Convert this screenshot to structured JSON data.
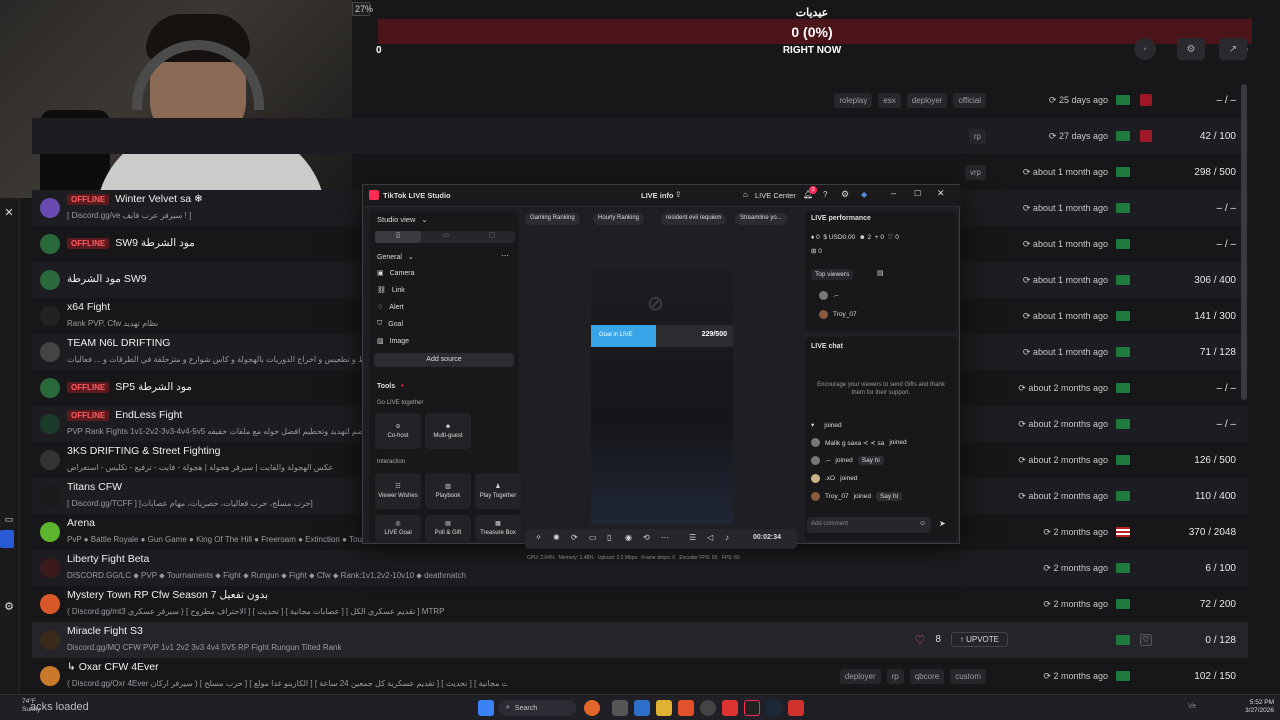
{
  "top": {
    "percent_tag": "27%",
    "title": "عيديات",
    "progress_text": "0 (0%)",
    "progress_min": "0",
    "progress_label": "RIGHT NOW",
    "progress_max": "100",
    "progress_fraction": 0.0
  },
  "rows": [
    {
      "offline": "",
      "name": "",
      "desc": "",
      "tags": [
        "roleplay",
        "esx",
        "deployer",
        "official"
      ],
      "time": "25 days ago",
      "count": "– / –",
      "fav": true
    },
    {
      "offline": "",
      "name": "",
      "desc": "",
      "tags": [
        "rp"
      ],
      "time": "27 days ago",
      "count": "42 / 100",
      "fav": true
    },
    {
      "offline": "",
      "name": "",
      "desc": "",
      "tags": [
        "vrp"
      ],
      "time": "about 1 month ago",
      "count": "298 / 500"
    },
    {
      "offline": "OFFLINE",
      "name": "Winter Velvet sa ❄",
      "desc": "[ Discord.gg/ve سيرفر عرب فايف ! ]",
      "tags": [],
      "time": "about 1 month ago",
      "count": "– / –"
    },
    {
      "offline": "OFFLINE",
      "name": "SW9 مود الشرطة",
      "desc": "",
      "tags": [],
      "time": "about 1 month ago",
      "count": "– / –"
    },
    {
      "offline": "",
      "name": "مود الشرطة SW9",
      "desc": "",
      "tags": [],
      "time": "about 1 month ago",
      "count": "306 / 400"
    },
    {
      "offline": "",
      "name": "x64 Fight",
      "desc": "Rank PVP, Cfw نظام تهديد",
      "tags": [],
      "time": "about 1 month ago",
      "count": "141 / 300"
    },
    {
      "offline": "",
      "name": "TEAM N6L DRIFTING",
      "desc": "حصرية استعراض تفحيط و تطعيس و اخراج الدوريات بالهجولة و كاس شوارع و متزحلقة في الطرقات و ... فعاليات ...",
      "tags": [],
      "time": "about 1 month ago",
      "count": "71 / 128"
    },
    {
      "offline": "OFFLINE",
      "name": "SP5 مود الشرطة",
      "desc": "",
      "tags": [],
      "time": "about 2 months ago",
      "count": "– / –"
    },
    {
      "offline": "OFFLINE",
      "name": "EndLess Fight",
      "desc": "PVP Rank Fights 1v1-2v2-3v3-4v4-5v5 انضم لتهديد وتحطيم افضل جوله مع ملفات خفيفه",
      "tags": [],
      "time": "about 2 months ago",
      "count": "– / –"
    },
    {
      "offline": "",
      "name": "3KS DRIFTING & Street Fighting",
      "desc": "عكس الهجولة والفايت | سيرفر هجولة | هجولة - فايت - ترفيع - تكليس - استعراض",
      "tags": [],
      "time": "about 2 months ago",
      "count": "126 / 500"
    },
    {
      "offline": "",
      "name": "Titans CFW",
      "desc": "[ Discord.gg/TCFF ] [حرب مسلح، حرب فعاليات، حصريات، مهام عصابات]",
      "tags": [],
      "time": "about 2 months ago",
      "count": "110 / 400"
    },
    {
      "offline": "",
      "name": "Arena",
      "desc": "PvP ● Battle Royale ● Gun Game ● King Of The Hill ● Freeroam ● Extinction ● Tourn",
      "tags": [],
      "time": "2 months ago",
      "count": "370 / 2048",
      "us": true
    },
    {
      "offline": "",
      "name": "Liberty Fight Beta",
      "desc": "DISCORD.GG/LC ⬥ PVP ⬥ Tournaments ⬥ Fight ⬥ Rungun ⬥ Fight ⬥ Cfw ⬥ Rank:1v1,2v2-10v10 ⬥ deathmatch",
      "tags": [],
      "time": "2 months ago",
      "count": "6 / 100"
    },
    {
      "offline": "",
      "name": "Mystery Town RP Cfw Season 7 بدون تفعيل",
      "desc": "( Discord.gg/mt3 سيرفر عسكري ) [ الاحتراف مطروح ] [ تحديث ] [ عصابات مجانية ] [ تقديم عسكري الكل ] MTRP",
      "tags": [],
      "time": "2 months ago",
      "count": "72 / 200"
    },
    {
      "offline": "",
      "name": "Miracle Fight S3",
      "desc": "Discord.gg/MQ CFW PVP 1v1 2v2 3v3 4v4 5V5 RP Fight Rungun Tilted Rank",
      "tags": [],
      "time": "",
      "count": "0 / 128",
      "upvotes": "8",
      "upvote_label": "UPVOTE",
      "heart": true
    },
    {
      "offline": "",
      "name": "↳ Oxar CFW 4Ever",
      "desc": "( Discord.gg/Oxr 4Ever سيرفر اركان ) [ حرب مسلح ] [ الكازينو غداً مولع ] [ تقديم عسكرية كل جمعين 24 ساعة ] [ تحديث ] [ عصابات مجانية ]",
      "tags": [
        "deployer",
        "rp",
        "qbcore",
        "custom"
      ],
      "time": "2 months ago",
      "count": "102 / 150"
    }
  ],
  "tiktok": {
    "title": "TikTok LIVE Studio",
    "live_info": "LIVE info",
    "live_center": "LIVE Center",
    "badge": "3",
    "studio_view": "Studio view",
    "general": "General",
    "sources": [
      "Camera",
      "Link",
      "Alert",
      "Goal",
      "Image"
    ],
    "add_source": "Add source",
    "tools": "Tools",
    "go_live_together": "Go LIVE together",
    "co_host": "Co-host",
    "multi_guest": "Multi-guest",
    "interaction": "Interaction",
    "viewer_wishes": "Viewer Wishes",
    "playbook": "Playbook",
    "play_together": "Play Together",
    "live_goal": "LIVE Goal",
    "poll_gift": "Poll & Gift",
    "treasure_box": "Treasure Box",
    "pills": [
      "Gaming Ranking",
      "Hourly Ranking",
      "resident evil requiem",
      "Streamline yo..."
    ],
    "goal_label": "Goal in LIVE",
    "goal_value": "229/500",
    "goal_fraction": 0.458,
    "timer": "00:02:34",
    "stats": [
      "CPU: 2.04%",
      "Memory: 1.48%",
      "Upload: 2.2 Mbps",
      "Frame drops: 0",
      "Encoder FPS: 60",
      "FPS: 60"
    ],
    "live_performance": "LIVE performance",
    "perf": [
      "0",
      "USD0.00",
      "2",
      "0",
      "0",
      "0"
    ],
    "top_viewers": "Top viewers",
    "viewers": [
      ".–",
      "Troy_07"
    ],
    "live_chat": "LIVE chat",
    "chat_hint": "Encourage your viewers to send Gifts and thank them for their support.",
    "chat": [
      {
        "user": "",
        "msg": "joined"
      },
      {
        "user": "Malik g saxa ≺ ≺ sa",
        "msg": "joined"
      },
      {
        "user": ".–",
        "msg": "joined",
        "sayhi": "Say hi"
      },
      {
        "user": ".xO",
        "msg": "joined"
      },
      {
        "user": "Troy_07",
        "msg": "joined",
        "sayhi": "Say hi"
      }
    ],
    "add_comment": "Add comment"
  },
  "taskbar": {
    "weather_temp": "74°F",
    "weather_desc": "Sunny",
    "status": "acks loaded",
    "search": "Search",
    "version": "Ve",
    "time": "5:52 PM",
    "date": "3/27/2026"
  },
  "colors": {
    "offline_bg": "#5a1a1e",
    "progress_bg": "#4a1418",
    "tiktok_blue": "#39a5e9"
  }
}
